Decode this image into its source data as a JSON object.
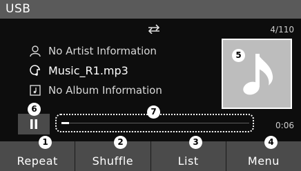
{
  "header": {
    "title": "USB"
  },
  "status": {
    "repeat_icon": "repeat-icon",
    "track_counter": "4/110",
    "elapsed_time": "0:06"
  },
  "track": {
    "artist": "No Artist Information",
    "title": "Music_R1.mp3",
    "album": "No Album Information",
    "artist_icon": "person-icon",
    "title_icon": "music-file-icon",
    "album_icon": "album-icon",
    "artwork_icon": "music-note-icon"
  },
  "playback": {
    "control_icon": "pause-icon",
    "progress": 0.04
  },
  "soft_keys": [
    {
      "label": "Repeat",
      "callout": "1"
    },
    {
      "label": "Shuffle",
      "callout": "2"
    },
    {
      "label": "List",
      "callout": "3"
    },
    {
      "label": "Menu",
      "callout": "4"
    }
  ],
  "callouts": {
    "album_art": "5",
    "pause_button": "6",
    "progress_bar": "7"
  },
  "colors": {
    "title_bar": "#5a5a5a",
    "screen_bg": "#0d0d0d",
    "soft_key_bg": "#4b4b4b",
    "album_art_bg": "#bdbdbd"
  }
}
